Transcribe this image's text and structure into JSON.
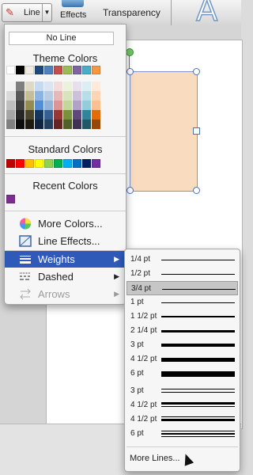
{
  "ribbon": {
    "line_label": "Line",
    "effects_label": "Effects",
    "transparency_label": "Transparency",
    "font_glyph": "A"
  },
  "menu": {
    "no_line": "No Line",
    "theme_colors_header": "Theme Colors",
    "theme_top": [
      "#ffffff",
      "#000000",
      "#eeece1",
      "#1f497d",
      "#4f81bd",
      "#c0504d",
      "#9bbb59",
      "#8064a2",
      "#4bacc6",
      "#f79646"
    ],
    "theme_tints": [
      [
        "#f2f2f2",
        "#d9d9d9",
        "#bfbfbf",
        "#a6a6a6",
        "#808080"
      ],
      [
        "#7f7f7f",
        "#595959",
        "#404040",
        "#262626",
        "#0d0d0d"
      ],
      [
        "#ddd9c3",
        "#c4bd97",
        "#948a54",
        "#4a452a",
        "#1d1b10"
      ],
      [
        "#c6d9f0",
        "#8db3e2",
        "#548dd4",
        "#17365d",
        "#0f243e"
      ],
      [
        "#dbe5f1",
        "#b8cce4",
        "#95b3d7",
        "#366092",
        "#244061"
      ],
      [
        "#f2dcdb",
        "#e5b9b7",
        "#d99694",
        "#953734",
        "#632423"
      ],
      [
        "#ebf1dd",
        "#d7e3bc",
        "#c3d69b",
        "#76923c",
        "#4f6128"
      ],
      [
        "#e5e0ec",
        "#ccc1d9",
        "#b2a2c7",
        "#5f497a",
        "#3f3151"
      ],
      [
        "#dbeef3",
        "#b7dde8",
        "#92cddc",
        "#31859b",
        "#205867"
      ],
      [
        "#fdeada",
        "#fbd5b5",
        "#fac08f",
        "#e36c09",
        "#974806"
      ]
    ],
    "standard_colors_header": "Standard Colors",
    "standard_colors": [
      "#c00000",
      "#ff0000",
      "#ffc000",
      "#ffff00",
      "#92d050",
      "#00b050",
      "#00b0f0",
      "#0070c0",
      "#002060",
      "#7030a0"
    ],
    "recent_colors_header": "Recent Colors",
    "recent_colors": [
      "#7b2e8e"
    ],
    "items": [
      {
        "label": "More Colors...",
        "icon": "color-wheel-icon"
      },
      {
        "label": "Line Effects...",
        "icon": "line-effects-icon"
      },
      {
        "label": "Weights",
        "icon": "weights-icon",
        "arrow": "▶"
      },
      {
        "label": "Dashed",
        "icon": "dashed-icon",
        "arrow": "▶"
      },
      {
        "label": "Arrows",
        "icon": "arrows-icon",
        "arrow": "▶"
      }
    ]
  },
  "weights": {
    "items": [
      {
        "label": "1/4 pt",
        "weight": 0.25
      },
      {
        "label": "1/2 pt",
        "weight": 0.5
      },
      {
        "label": "3/4 pt",
        "weight": 0.75,
        "selected": true
      },
      {
        "label": "1 pt",
        "weight": 1
      },
      {
        "label": "1 1/2 pt",
        "weight": 1.5
      },
      {
        "label": "2 1/4 pt",
        "weight": 2.25
      },
      {
        "label": "3 pt",
        "weight": 3
      },
      {
        "label": "4 1/2 pt",
        "weight": 4.5
      },
      {
        "label": "6 pt",
        "weight": 6
      },
      {
        "label": "3 pt",
        "weight": 3,
        "compound": "double"
      },
      {
        "label": "4 1/2 pt",
        "weight": 4.5,
        "compound": "thick-thin"
      },
      {
        "label": "4 1/2 pt",
        "weight": 4.5,
        "compound": "thin-thick"
      },
      {
        "label": "6 pt",
        "weight": 6,
        "compound": "triple"
      }
    ],
    "more_lines": "More Lines..."
  },
  "colors": {
    "accent": "#2f5ab8",
    "shape_fill": "#f9dcc0",
    "shape_border": "#7c97c4"
  }
}
